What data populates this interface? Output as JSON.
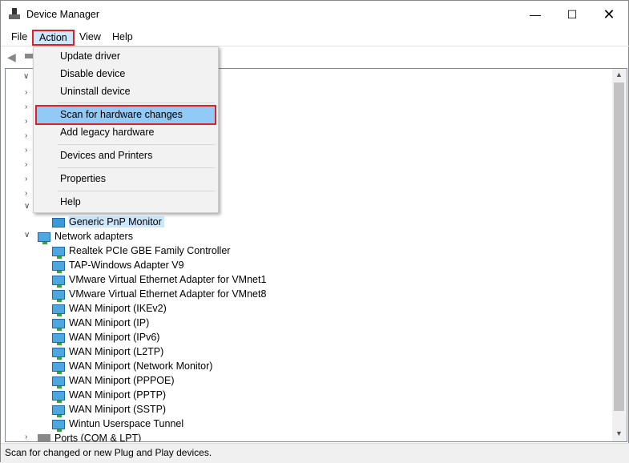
{
  "window": {
    "title": "Device Manager",
    "controls": [
      "minimize",
      "maximize",
      "close"
    ]
  },
  "menubar": [
    {
      "label": "File"
    },
    {
      "label": "Action",
      "active": true
    },
    {
      "label": "View"
    },
    {
      "label": "Help"
    }
  ],
  "action_menu": {
    "items": [
      {
        "label": "Update driver"
      },
      {
        "label": "Disable device"
      },
      {
        "label": "Uninstall device"
      },
      {
        "label": "Scan for hardware changes",
        "highlighted": true
      },
      {
        "label": "Add legacy hardware"
      },
      {
        "label": "Devices and Printers"
      },
      {
        "label": "Properties"
      },
      {
        "label": "Help"
      }
    ]
  },
  "tree": {
    "monitor_child": "Generic PnP Monitor",
    "network_adapters": {
      "label": "Network adapters",
      "children": [
        "Realtek PCIe GBE Family Controller",
        "TAP-Windows Adapter V9",
        "VMware Virtual Ethernet Adapter for VMnet1",
        "VMware Virtual Ethernet Adapter for VMnet8",
        "WAN Miniport (IKEv2)",
        "WAN Miniport (IP)",
        "WAN Miniport (IPv6)",
        "WAN Miniport (L2TP)",
        "WAN Miniport (Network Monitor)",
        "WAN Miniport (PPPOE)",
        "WAN Miniport (PPTP)",
        "WAN Miniport (SSTP)",
        "Wintun Userspace Tunnel"
      ]
    },
    "ports": "Ports (COM & LPT)"
  },
  "status_bar": "Scan for changed or new Plug and Play devices.",
  "colors": {
    "highlight_border": "#e02020",
    "selection": "#cce8ff",
    "menu_hover": "#91c9f7"
  }
}
